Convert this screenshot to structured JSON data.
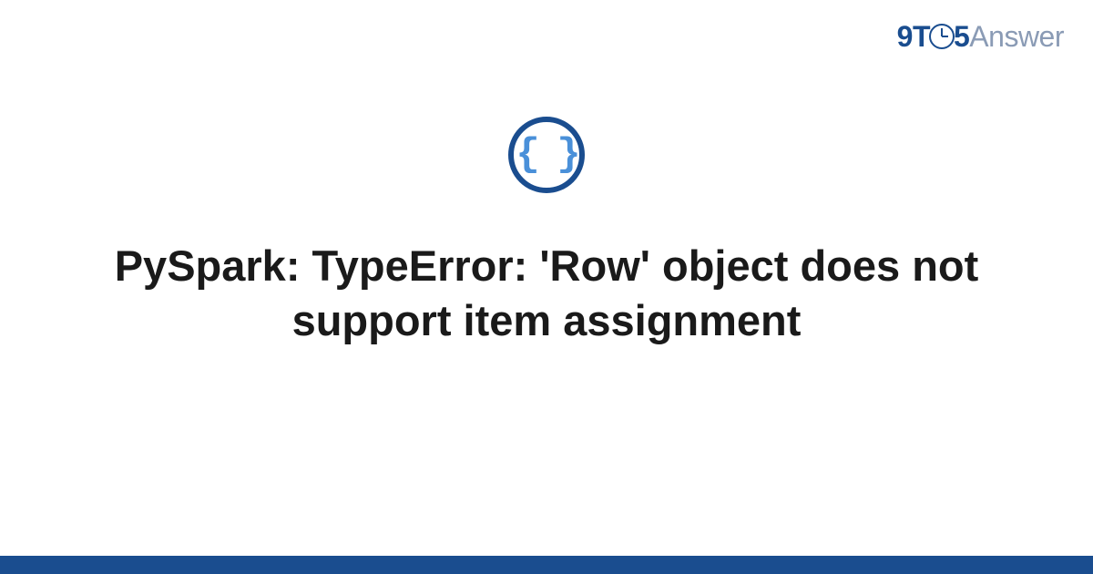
{
  "logo": {
    "part1": "9",
    "part2": "T",
    "part3": "5",
    "part4": "Answer"
  },
  "icon": {
    "symbol": "{ }"
  },
  "title": "PySpark: TypeError: 'Row' object does not support item assignment"
}
